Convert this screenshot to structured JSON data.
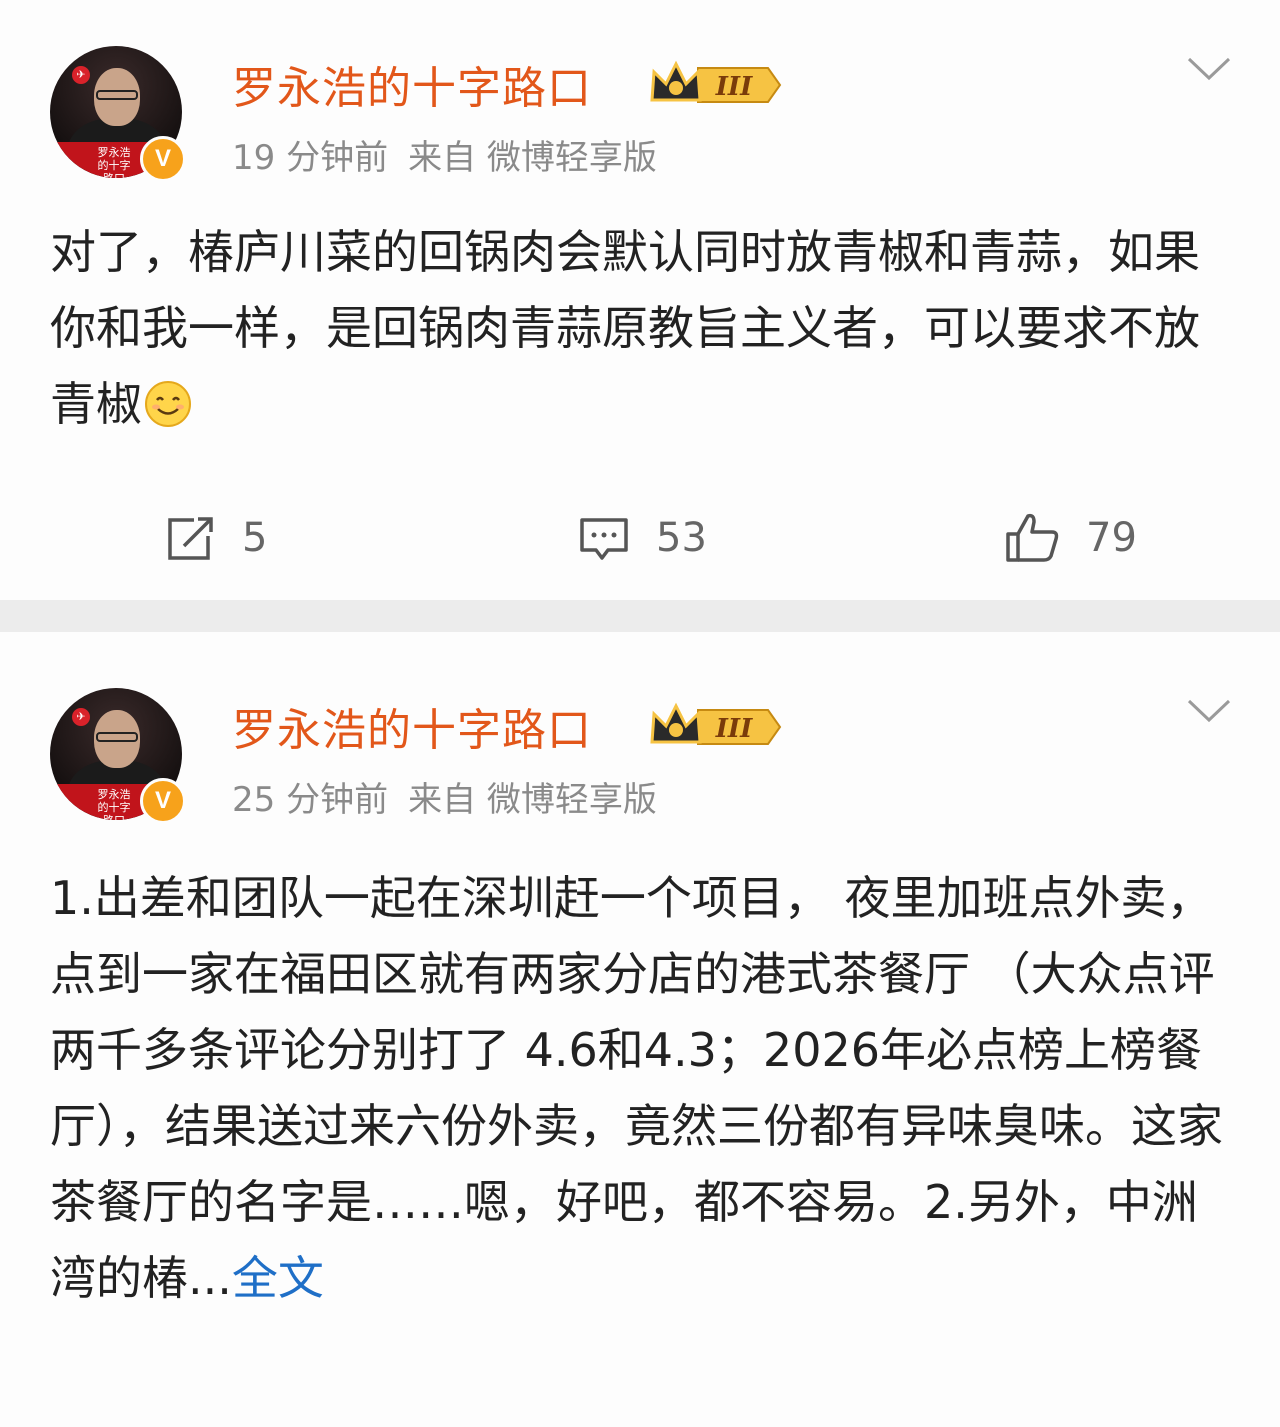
{
  "posts": [
    {
      "username": "罗永浩的十字路口",
      "level_badge": "III",
      "avatar_caption": "罗永浩的十字路口",
      "verified_mark": "V",
      "time": "19 分钟前",
      "source": "来自 微博轻享版",
      "text": "对了，椿庐川菜的回锅肉会默认同时放青椒和青蒜，如果你和我一样，是回锅肉青蒜原教旨主义者，可以要求不放青椒",
      "emoji": "smiley-face-icon",
      "actions": {
        "repost_count": "5",
        "comment_count": "53",
        "like_count": "79"
      }
    },
    {
      "username": "罗永浩的十字路口",
      "level_badge": "III",
      "avatar_caption": "罗永浩的十字路口",
      "verified_mark": "V",
      "time": "25 分钟前",
      "source": "来自 微博轻享版",
      "text": "1.出差和团队一起在深圳赶一个项目， 夜里加班点外卖，点到一家在福田区就有两家分店的港式茶餐厅 （大众点评两千多条评论分别打了 4.6和4.3；2026年必点榜上榜餐厅），结果送过来六份外卖，竟然三份都有异味臭味。这家茶餐厅的名字是……嗯，好吧，都不容易。2.另外，中洲湾的椿...",
      "more_link": "全文"
    }
  ],
  "colors": {
    "username": "#e2571a",
    "link": "#1f6fc7",
    "verified": "#f7a21b"
  }
}
